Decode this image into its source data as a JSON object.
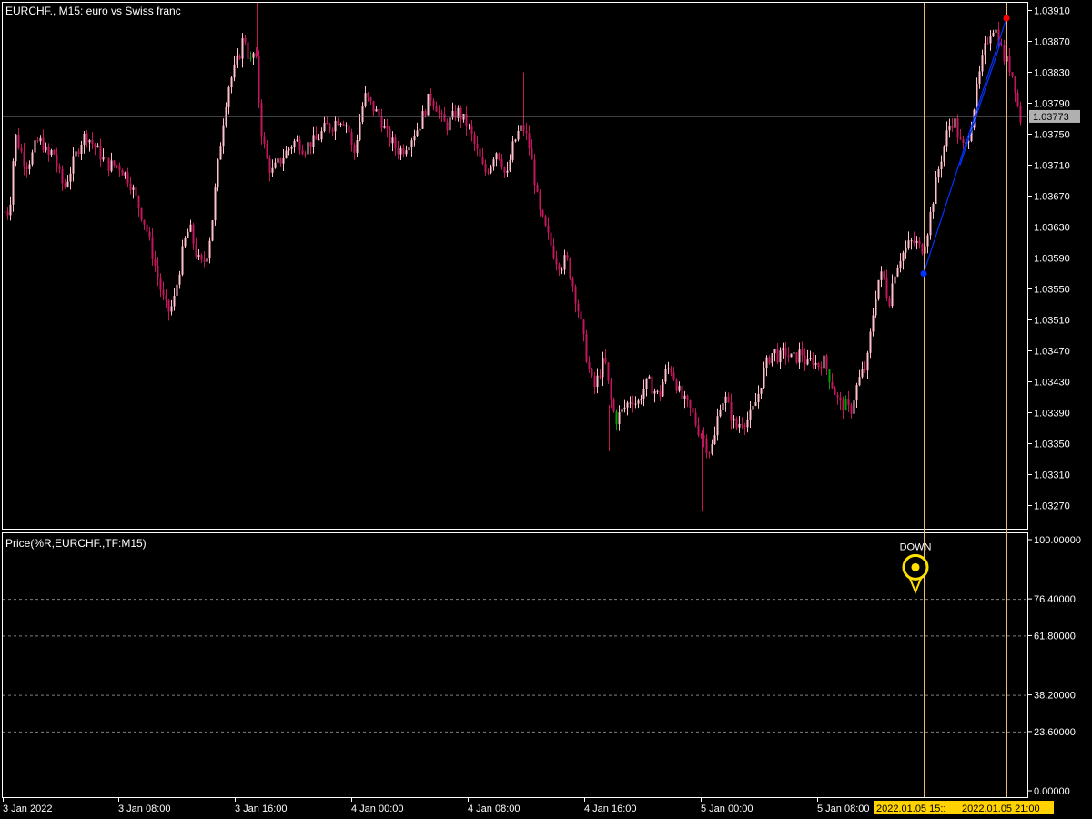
{
  "window": {
    "symbol_title": "EURCHF., M15:  euro vs Swiss franc",
    "indicator_title": "Price(%R,EURCHF.,TF:M15)"
  },
  "colors": {
    "background": "#000000",
    "frame": "#ffffff",
    "candle_bear": "#c2185b",
    "candle_bull": "#ffc0cb",
    "candle_green": "#00a000",
    "crosshair_vertical": "#e8b878",
    "bid_line": "#808080",
    "current_price_bg": "#b0b0b0",
    "trend_line": "#0033ff",
    "point_start": "#0033ff",
    "point_end": "#ff0000",
    "marker": "#ffe000",
    "time_label_bg": "#ffd200",
    "level_line": "#808080"
  },
  "chart_data": [
    {
      "type": "candlestick",
      "symbol": "EURCHF.",
      "timeframe": "M15",
      "y_ticks": [
        "1.03910",
        "1.03870",
        "1.03830",
        "1.03790",
        "1.03750",
        "1.03710",
        "1.03670",
        "1.03630",
        "1.03590",
        "1.03550",
        "1.03510",
        "1.03470",
        "1.03430",
        "1.03390",
        "1.03350",
        "1.03310",
        "1.03270"
      ],
      "ylim": [
        1.0324,
        1.0392
      ],
      "current_price_label": "1.03773",
      "current_price": 1.03773,
      "x_ticks": [
        "3 Jan 2022",
        "3 Jan 08:00",
        "3 Jan 16:00",
        "4 Jan 00:00",
        "4 Jan 08:00",
        "4 Jan 16:00",
        "5 Jan 00:00",
        "5 Jan 08:00"
      ],
      "time_labels": [
        "2022.01.05 15::",
        "2022.01.05 21:00"
      ],
      "close_path": [
        [
          0,
          1.0362
        ],
        [
          5,
          1.0365
        ],
        [
          10,
          1.0365
        ],
        [
          16,
          1.0375
        ],
        [
          22,
          1.0373
        ],
        [
          28,
          1.0371
        ],
        [
          34,
          1.0372
        ],
        [
          40,
          1.0374
        ],
        [
          46,
          1.0374
        ],
        [
          52,
          1.0372
        ],
        [
          58,
          1.0373
        ],
        [
          64,
          1.037
        ],
        [
          70,
          1.0368
        ],
        [
          76,
          1.037
        ],
        [
          82,
          1.0372
        ],
        [
          88,
          1.0374
        ],
        [
          94,
          1.0375
        ],
        [
          100,
          1.0374
        ],
        [
          106,
          1.0373
        ],
        [
          112,
          1.0372
        ],
        [
          118,
          1.0371
        ],
        [
          124,
          1.0371
        ],
        [
          130,
          1.0371
        ],
        [
          136,
          1.037
        ],
        [
          142,
          1.0369
        ],
        [
          148,
          1.0367
        ],
        [
          154,
          1.0365
        ],
        [
          160,
          1.0363
        ],
        [
          166,
          1.036
        ],
        [
          172,
          1.0357
        ],
        [
          178,
          1.0354
        ],
        [
          184,
          1.0352
        ],
        [
          190,
          1.0353
        ],
        [
          196,
          1.0357
        ],
        [
          202,
          1.0361
        ],
        [
          208,
          1.0363
        ],
        [
          214,
          1.036
        ],
        [
          220,
          1.0358
        ],
        [
          226,
          1.0359
        ],
        [
          232,
          1.0363
        ],
        [
          238,
          1.037
        ],
        [
          244,
          1.0376
        ],
        [
          250,
          1.0381
        ],
        [
          256,
          1.0383
        ],
        [
          262,
          1.0385
        ],
        [
          268,
          1.0388
        ],
        [
          274,
          1.0384
        ],
        [
          280,
          1.0386
        ],
        [
          286,
          1.0376
        ],
        [
          292,
          1.0372
        ],
        [
          298,
          1.037
        ],
        [
          304,
          1.0371
        ],
        [
          310,
          1.0372
        ],
        [
          316,
          1.0373
        ],
        [
          322,
          1.0374
        ],
        [
          328,
          1.0374
        ],
        [
          334,
          1.0373
        ],
        [
          340,
          1.0374
        ],
        [
          346,
          1.0374
        ],
        [
          352,
          1.0375
        ],
        [
          358,
          1.0376
        ],
        [
          364,
          1.0376
        ],
        [
          370,
          1.0377
        ],
        [
          376,
          1.0377
        ],
        [
          382,
          1.0376
        ],
        [
          388,
          1.0372
        ],
        [
          394,
          1.0376
        ],
        [
          400,
          1.038
        ],
        [
          406,
          1.0379
        ],
        [
          412,
          1.0378
        ],
        [
          418,
          1.0377
        ],
        [
          424,
          1.0375
        ],
        [
          430,
          1.0374
        ],
        [
          436,
          1.0373
        ],
        [
          442,
          1.0373
        ],
        [
          448,
          1.0374
        ],
        [
          454,
          1.0375
        ],
        [
          460,
          1.0376
        ],
        [
          466,
          1.0378
        ],
        [
          472,
          1.038
        ],
        [
          478,
          1.0379
        ],
        [
          484,
          1.0377
        ],
        [
          490,
          1.0376
        ],
        [
          496,
          1.0377
        ],
        [
          502,
          1.0378
        ],
        [
          508,
          1.0377
        ],
        [
          514,
          1.0376
        ],
        [
          520,
          1.0374
        ],
        [
          526,
          1.0372
        ],
        [
          532,
          1.037
        ],
        [
          538,
          1.0371
        ],
        [
          544,
          1.0373
        ],
        [
          550,
          1.0372
        ],
        [
          556,
          1.0369
        ],
        [
          562,
          1.0373
        ],
        [
          568,
          1.0375
        ],
        [
          574,
          1.0376
        ],
        [
          580,
          1.0374
        ],
        [
          586,
          1.037
        ],
        [
          592,
          1.0365
        ],
        [
          598,
          1.0363
        ],
        [
          604,
          1.0361
        ],
        [
          610,
          1.0359
        ],
        [
          616,
          1.0358
        ],
        [
          622,
          1.0359
        ],
        [
          628,
          1.0356
        ],
        [
          634,
          1.0353
        ],
        [
          640,
          1.0349
        ],
        [
          646,
          1.0345
        ],
        [
          652,
          1.0342
        ],
        [
          658,
          1.0344
        ],
        [
          664,
          1.0346
        ],
        [
          670,
          1.0341
        ],
        [
          676,
          1.0338
        ],
        [
          682,
          1.0339
        ],
        [
          688,
          1.034
        ],
        [
          694,
          1.0341
        ],
        [
          700,
          1.034
        ],
        [
          706,
          1.0342
        ],
        [
          712,
          1.0343
        ],
        [
          718,
          1.0342
        ],
        [
          724,
          1.0341
        ],
        [
          730,
          1.0344
        ],
        [
          736,
          1.0345
        ],
        [
          742,
          1.0343
        ],
        [
          748,
          1.0341
        ],
        [
          754,
          1.034
        ],
        [
          760,
          1.0339
        ],
        [
          766,
          1.0337
        ],
        [
          772,
          1.0336
        ],
        [
          778,
          1.0334
        ],
        [
          784,
          1.0335
        ],
        [
          790,
          1.034
        ],
        [
          796,
          1.0341
        ],
        [
          802,
          1.0339
        ],
        [
          808,
          1.0337
        ],
        [
          814,
          1.0338
        ],
        [
          820,
          1.0338
        ],
        [
          826,
          1.0339
        ],
        [
          832,
          1.0341
        ],
        [
          838,
          1.0344
        ],
        [
          844,
          1.0346
        ],
        [
          850,
          1.0347
        ],
        [
          856,
          1.0346
        ],
        [
          862,
          1.0347
        ],
        [
          868,
          1.0346
        ],
        [
          874,
          1.0346
        ],
        [
          880,
          1.0347
        ],
        [
          886,
          1.0345
        ],
        [
          892,
          1.0346
        ],
        [
          898,
          1.0345
        ],
        [
          904,
          1.0346
        ],
        [
          910,
          1.0344
        ],
        [
          916,
          1.0342
        ],
        [
          922,
          1.034
        ],
        [
          928,
          1.034
        ],
        [
          934,
          1.0339
        ],
        [
          940,
          1.0342
        ],
        [
          946,
          1.0344
        ],
        [
          952,
          1.0345
        ],
        [
          958,
          1.0351
        ],
        [
          964,
          1.0356
        ],
        [
          970,
          1.0357
        ],
        [
          976,
          1.0353
        ],
        [
          982,
          1.0357
        ],
        [
          988,
          1.0359
        ],
        [
          994,
          1.036
        ],
        [
          1000,
          1.0361
        ],
        [
          1006,
          1.0361
        ],
        [
          1012,
          1.036
        ],
        [
          1018,
          1.0362
        ],
        [
          1024,
          1.0366
        ],
        [
          1030,
          1.037
        ],
        [
          1036,
          1.0373
        ],
        [
          1042,
          1.0376
        ],
        [
          1048,
          1.0377
        ],
        [
          1054,
          1.0374
        ],
        [
          1060,
          1.0373
        ],
        [
          1066,
          1.0376
        ],
        [
          1072,
          1.038
        ],
        [
          1078,
          1.0384
        ],
        [
          1084,
          1.0387
        ],
        [
          1090,
          1.0389
        ],
        [
          1096,
          1.0388
        ],
        [
          1102,
          1.0385
        ],
        [
          1108,
          1.0384
        ],
        [
          1114,
          1.0382
        ],
        [
          1120,
          1.0377
        ]
      ],
      "trend_line": {
        "start": {
          "x": 1015,
          "price": 1.0357
        },
        "end": {
          "x": 1106,
          "price": 1.039
        }
      },
      "extra_trend_segment": {
        "start": {
          "x": 1055,
          "price": 1.0371
        },
        "end": {
          "x": 1100,
          "price": 1.0387
        }
      },
      "vertical_lines_x": [
        1015,
        1106
      ]
    },
    {
      "type": "indicator",
      "name": "Price(%R,EURCHF.,TF:M15)",
      "y_ticks": [
        "100.00000",
        "76.40000",
        "61.80000",
        "38.20000",
        "23.60000",
        "0.00000"
      ],
      "level_values": [
        76.4,
        61.8,
        38.2,
        23.6
      ],
      "ylim": [
        0,
        100
      ],
      "marker": {
        "label": "DOWN",
        "x": 1006,
        "value": 89
      }
    }
  ]
}
